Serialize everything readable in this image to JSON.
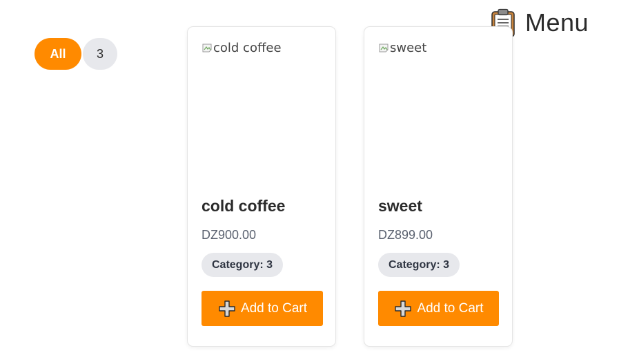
{
  "header": {
    "menu_label": "Menu",
    "icon": "clipboard-icon"
  },
  "filters": [
    {
      "label": "All",
      "active": true
    },
    {
      "label": "3",
      "active": false
    }
  ],
  "products": [
    {
      "image_alt": "cold coffee",
      "name": "cold coffee",
      "price": "DZ900.00",
      "category": "Category: 3",
      "button_label": "Add to Cart",
      "button_icon": "plus-icon"
    },
    {
      "image_alt": "sweet",
      "name": "sweet",
      "price": "DZ899.00",
      "category": "Category: 3",
      "button_label": "Add to Cart",
      "button_icon": "plus-icon"
    }
  ],
  "colors": {
    "accent": "#ff8a00",
    "chip_bg": "#e7e8ec",
    "text_dark": "#2b2b2b",
    "price_text": "#5b6270"
  }
}
